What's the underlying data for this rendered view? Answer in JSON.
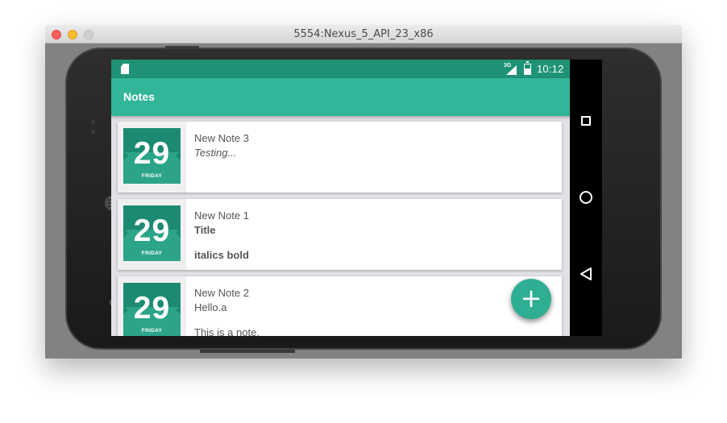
{
  "window": {
    "title": "5554:Nexus_5_API_23_x86"
  },
  "statusbar": {
    "network": "3G",
    "time": "10:12"
  },
  "toolbar": {
    "title": "Notes"
  },
  "notes": [
    {
      "day": "29",
      "weekday": "FRIDAY",
      "title": "New Note 3",
      "lines": [
        "Testing..."
      ]
    },
    {
      "day": "29",
      "weekday": "FRIDAY",
      "title": "New Note 1",
      "lines": [
        "Title",
        "italics bold"
      ]
    },
    {
      "day": "29",
      "weekday": "FRIDAY",
      "title": "New Note 2",
      "lines": [
        "Hello.a",
        "This is a note."
      ]
    }
  ],
  "fab": {
    "icon": "plus-icon",
    "label": "+"
  },
  "navigation": {
    "recents_icon": "recents-icon",
    "home_icon": "home-icon",
    "back_icon": "back-icon"
  },
  "colors": {
    "statusbar": "#1e9277",
    "toolbar": "#33b59a",
    "accent": "#2fae94"
  }
}
